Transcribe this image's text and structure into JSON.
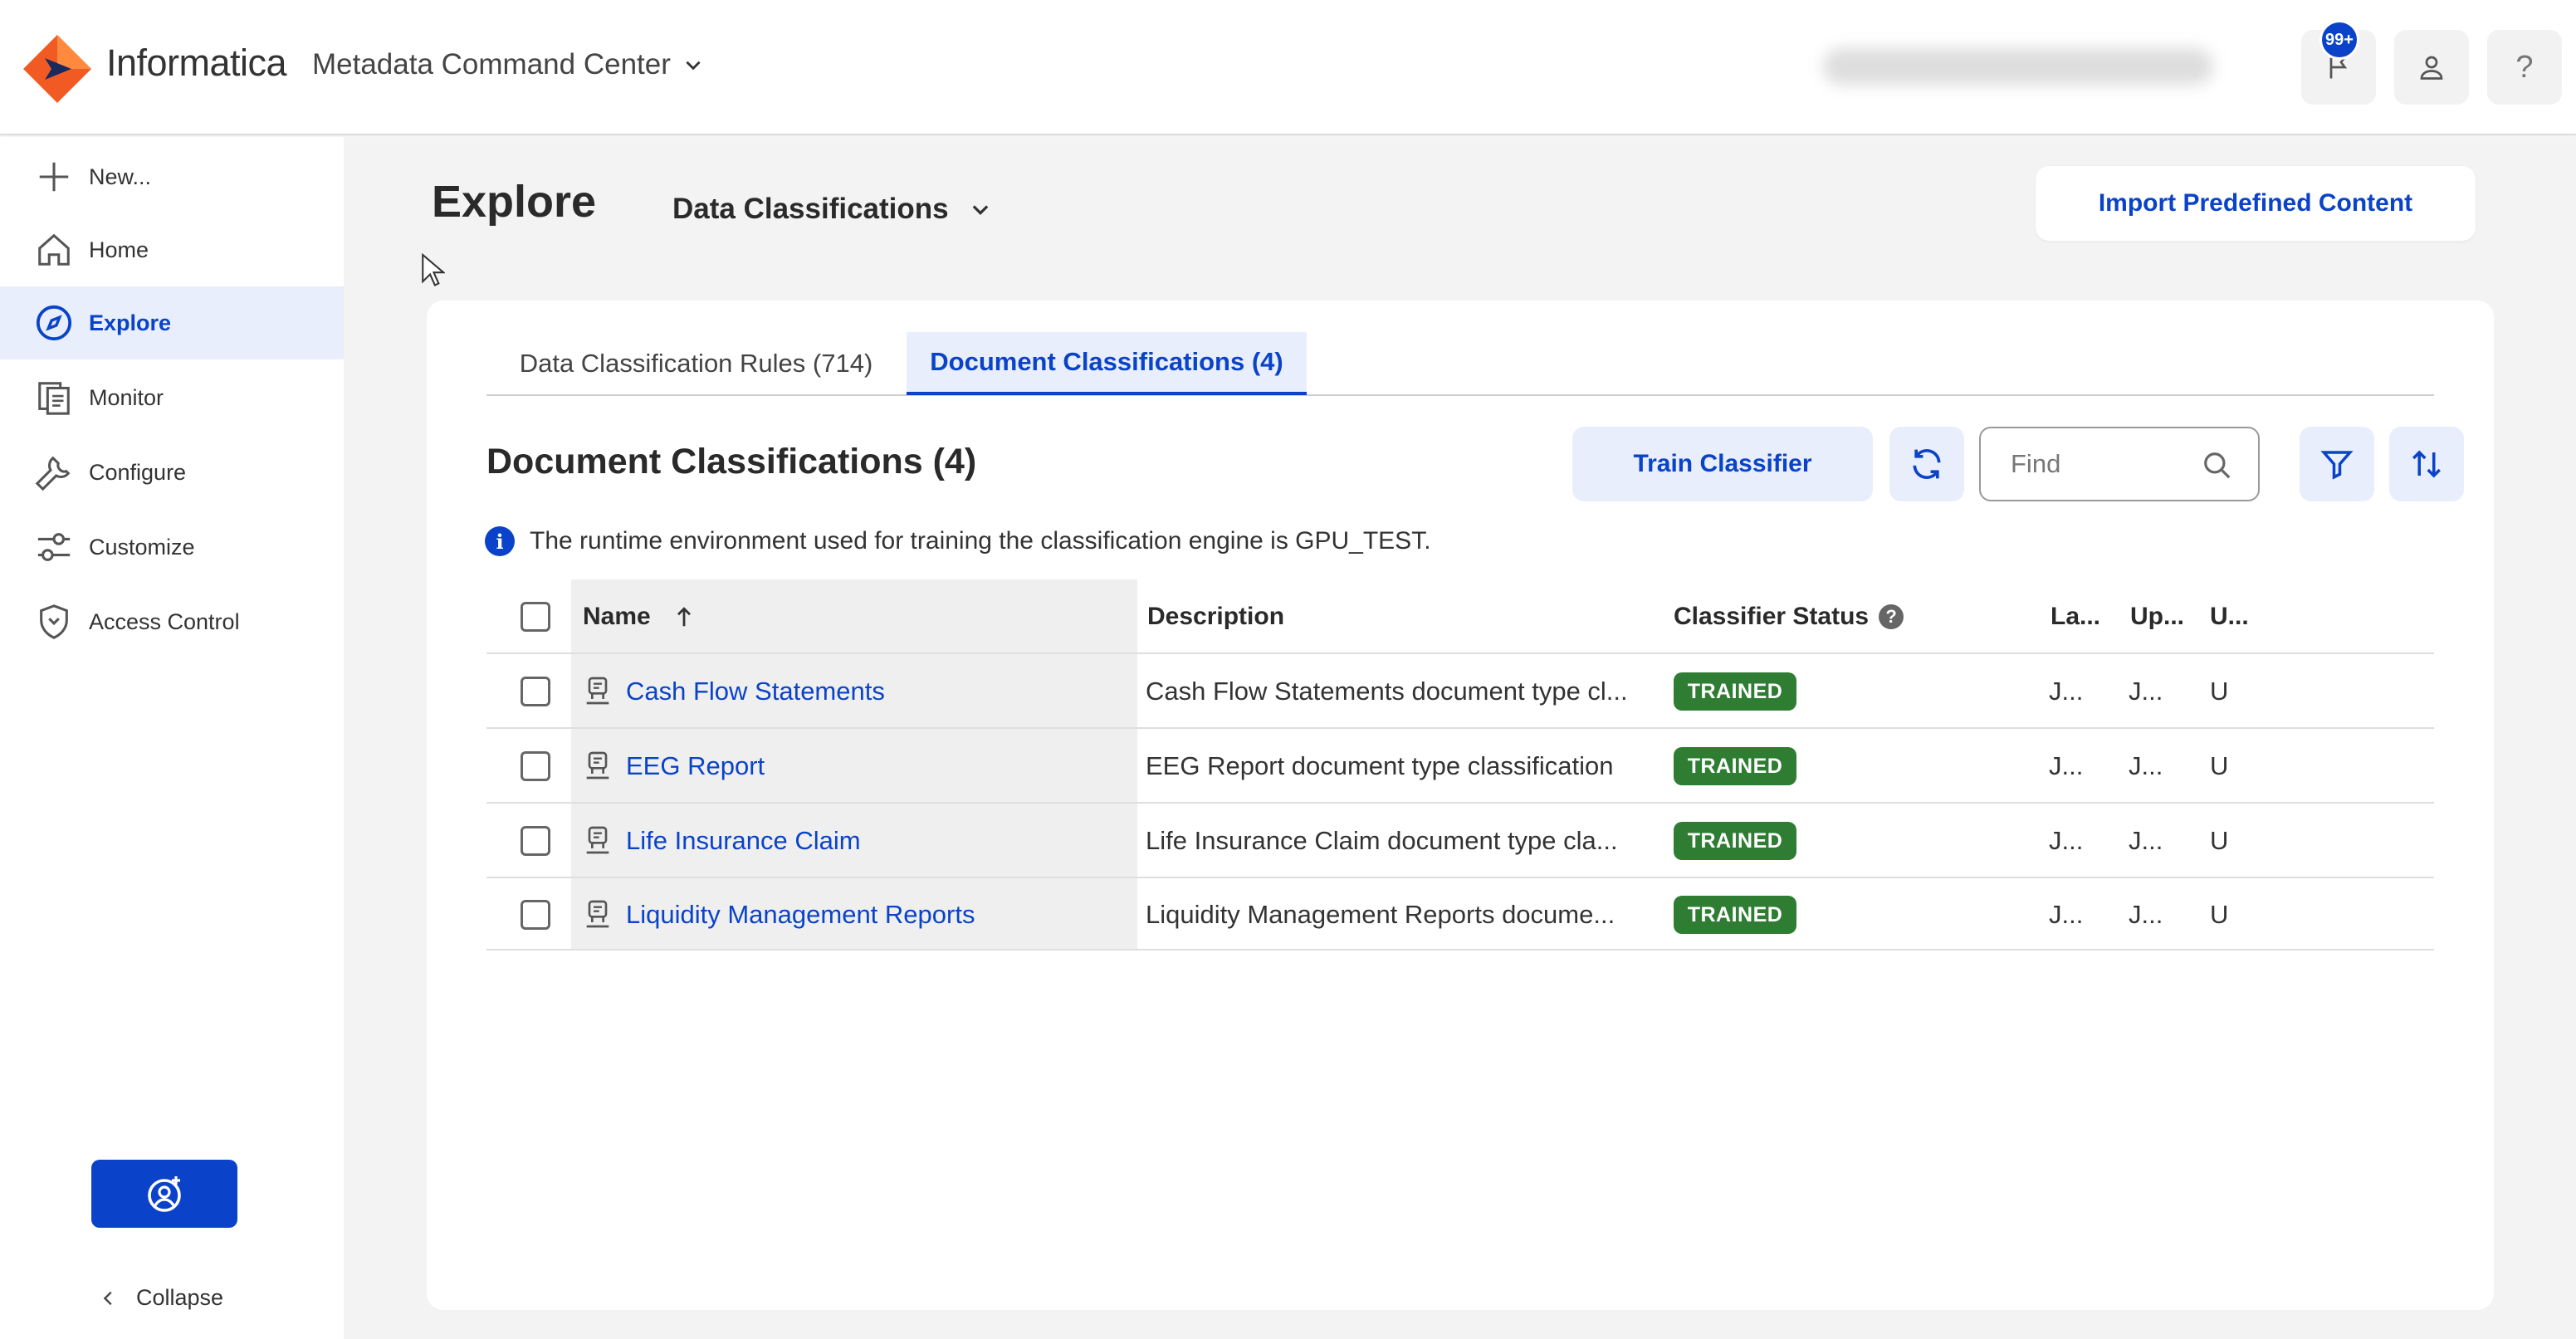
{
  "header": {
    "brand": "Informatica",
    "app_name": "Metadata Command Center",
    "notification_count": "99+",
    "help_glyph": "?"
  },
  "sidebar": {
    "items": [
      {
        "label": "New...",
        "icon": "plus-icon"
      },
      {
        "label": "Home",
        "icon": "home-icon"
      },
      {
        "label": "Explore",
        "icon": "compass-icon",
        "active": true
      },
      {
        "label": "Monitor",
        "icon": "documents-icon"
      },
      {
        "label": "Configure",
        "icon": "wrench-icon"
      },
      {
        "label": "Customize",
        "icon": "sliders-icon"
      },
      {
        "label": "Access Control",
        "icon": "shield-icon"
      }
    ],
    "collapse_label": "Collapse"
  },
  "page": {
    "title": "Explore",
    "asset_type": "Data Classifications",
    "import_label": "Import Predefined Content"
  },
  "tabs": [
    {
      "label": "Data Classification Rules (714)",
      "active": false
    },
    {
      "label": "Document Classifications (4)",
      "active": true
    }
  ],
  "section": {
    "title": "Document Classifications (4)",
    "train_label": "Train Classifier",
    "find_placeholder": "Find",
    "info_text": "The runtime environment used for training the classification engine is GPU_TEST."
  },
  "table": {
    "columns": [
      "Name",
      "Description",
      "Classifier Status",
      "La...",
      "Up...",
      "U..."
    ],
    "rows": [
      {
        "name": "Cash Flow Statements",
        "description": "Cash Flow Statements document type cl...",
        "status": "TRAINED",
        "la": "J...",
        "up": "J...",
        "u": "U"
      },
      {
        "name": "EEG Report",
        "description": "EEG Report document type classification",
        "status": "TRAINED",
        "la": "J...",
        "up": "J...",
        "u": "U"
      },
      {
        "name": "Life Insurance Claim",
        "description": "Life Insurance Claim document type cla...",
        "status": "TRAINED",
        "la": "J...",
        "up": "J...",
        "u": "U"
      },
      {
        "name": "Liquidity Management Reports",
        "description": "Liquidity Management Reports docume...",
        "status": "TRAINED",
        "la": "J...",
        "up": "J...",
        "u": "U"
      }
    ]
  },
  "colors": {
    "accent": "#0a43c9",
    "trained": "#2e7d32",
    "logo_orange": "#f15a22"
  }
}
